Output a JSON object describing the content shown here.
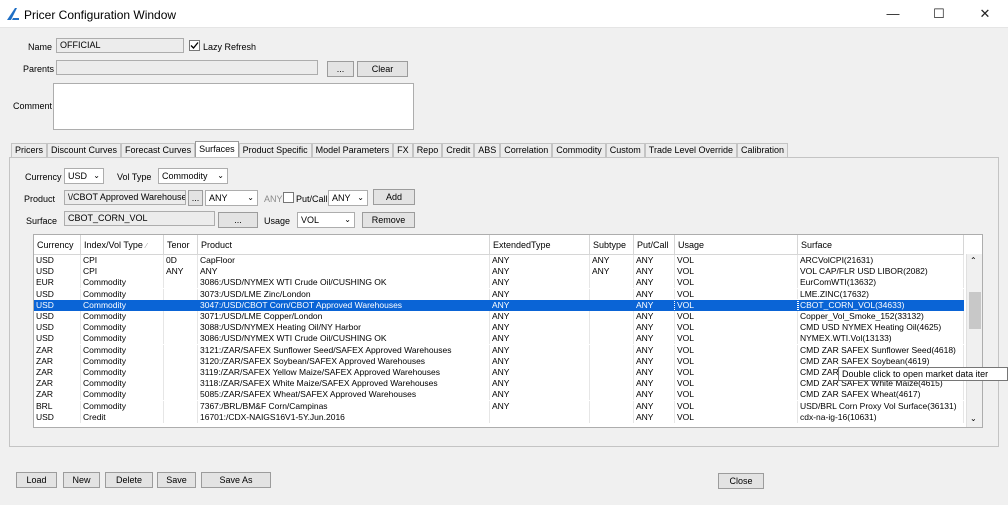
{
  "window": {
    "title": "Pricer Configuration Window",
    "minimize": "—",
    "maximize": "☐",
    "close": "✕"
  },
  "form": {
    "name_label": "Name",
    "name_value": "OFFICIAL",
    "lazy_refresh_label": "Lazy Refresh",
    "lazy_refresh_checked": true,
    "parents_label": "Parents",
    "parents_value": "",
    "browse_label": "...",
    "clear_label": "Clear",
    "comment_label": "Comment",
    "comment_value": ""
  },
  "tabs": [
    "Pricers",
    "Discount Curves",
    "Forecast Curves",
    "Surfaces",
    "Product Specific",
    "Model Parameters",
    "FX",
    "Repo",
    "Credit",
    "ABS",
    "Correlation",
    "Commodity",
    "Custom",
    "Trade Level Override",
    "Calibration"
  ],
  "active_tab": "Surfaces",
  "filters": {
    "currency_label": "Currency",
    "currency_value": "USD",
    "vol_type_label": "Vol Type",
    "vol_type_value": "Commodity",
    "product_label": "Product",
    "product_value": "\\/CBOT Approved Warehouses",
    "product_browse": "...",
    "product_any": "ANY",
    "any_disabled": "ANY",
    "putcall_label": "Put/Call",
    "putcall_value": "ANY",
    "add_label": "Add",
    "surface_label": "Surface",
    "surface_value": "CBOT_CORN_VOL",
    "surface_browse": "...",
    "usage_label": "Usage",
    "usage_value": "VOL",
    "remove_label": "Remove"
  },
  "table": {
    "columns": [
      "Currency",
      "Index/Vol Type",
      "Tenor",
      "Product",
      "ExtendedType",
      "Subtype",
      "Put/Call",
      "Usage",
      "Surface"
    ],
    "sort_indicator": "⁄",
    "selected_row": 4,
    "rows": [
      [
        "USD",
        "CPI",
        "0D",
        "CapFloor",
        "ANY",
        "ANY",
        "ANY",
        "VOL",
        "ARCVolCPI(21631)"
      ],
      [
        "USD",
        "CPI",
        "ANY",
        "ANY",
        "ANY",
        "ANY",
        "ANY",
        "VOL",
        "VOL CAP/FLR USD LIBOR(2082)"
      ],
      [
        "EUR",
        "Commodity",
        "",
        "3086:/USD/NYMEX WTI Crude Oil/CUSHING OK",
        "ANY",
        "",
        "ANY",
        "VOL",
        "EurComWTI(13632)"
      ],
      [
        "USD",
        "Commodity",
        "",
        "3073:/USD/LME Zinc/London",
        "ANY",
        "",
        "ANY",
        "VOL",
        "LME.ZINC(17632)"
      ],
      [
        "USD",
        "Commodity",
        "",
        "3047:/USD/CBOT Corn/CBOT Approved Warehouses",
        "ANY",
        "",
        "ANY",
        "VOL",
        "CBOT_CORN_VOL(34633)"
      ],
      [
        "USD",
        "Commodity",
        "",
        "3071:/USD/LME Copper/London",
        "ANY",
        "",
        "ANY",
        "VOL",
        "Copper_Vol_Smoke_152(33132)"
      ],
      [
        "USD",
        "Commodity",
        "",
        "3088:/USD/NYMEX Heating Oil/NY Harbor",
        "ANY",
        "",
        "ANY",
        "VOL",
        "CMD USD NYMEX Heating Oil(4625)"
      ],
      [
        "USD",
        "Commodity",
        "",
        "3086:/USD/NYMEX WTI Crude Oil/CUSHING OK",
        "ANY",
        "",
        "ANY",
        "VOL",
        "NYMEX.WTI.Vol(13133)"
      ],
      [
        "ZAR",
        "Commodity",
        "",
        "3121:/ZAR/SAFEX Sunflower Seed/SAFEX Approved Warehouses",
        "ANY",
        "",
        "ANY",
        "VOL",
        "CMD ZAR SAFEX Sunflower Seed(4618)"
      ],
      [
        "ZAR",
        "Commodity",
        "",
        "3120:/ZAR/SAFEX Soybean/SAFEX Approved Warehouses",
        "ANY",
        "",
        "ANY",
        "VOL",
        "CMD ZAR SAFEX Soybean(4619)"
      ],
      [
        "ZAR",
        "Commodity",
        "",
        "3119:/ZAR/SAFEX Yellow Maize/SAFEX Approved Warehouses",
        "ANY",
        "",
        "ANY",
        "VOL",
        "CMD ZAR"
      ],
      [
        "ZAR",
        "Commodity",
        "",
        "3118:/ZAR/SAFEX White Maize/SAFEX Approved Warehouses",
        "ANY",
        "",
        "ANY",
        "VOL",
        "CMD ZAR SAFEX White Maize(4615)"
      ],
      [
        "ZAR",
        "Commodity",
        "",
        "5085:/ZAR/SAFEX Wheat/SAFEX Approved Warehouses",
        "ANY",
        "",
        "ANY",
        "VOL",
        "CMD ZAR SAFEX Wheat(4617)"
      ],
      [
        "BRL",
        "Commodity",
        "",
        "7367:/BRL/BM&F Corn/Campinas",
        "ANY",
        "",
        "ANY",
        "VOL",
        "USD/BRL Corn Proxy Vol Surface(36131)"
      ],
      [
        "USD",
        "Credit",
        "",
        "16701:/CDX-NAIGS16V1-5Y.Jun.2016",
        "",
        "",
        "ANY",
        "VOL",
        "cdx-na-ig-16(10631)"
      ]
    ]
  },
  "tooltip": "Double click to open market data iter",
  "bottom": {
    "load": "Load",
    "new": "New",
    "delete": "Delete",
    "save": "Save",
    "save_as": "Save As",
    "close": "Close"
  },
  "colors": {
    "selection": "#0a64d6",
    "accent": "#1f6fc5"
  }
}
